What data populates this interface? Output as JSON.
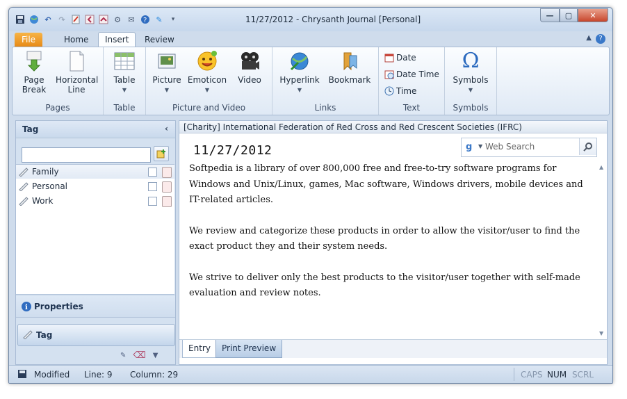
{
  "window": {
    "title": "11/27/2012 - Chrysanth Journal [Personal]",
    "controls": {
      "minimize": "—",
      "maximize": "▢",
      "close": "✕"
    }
  },
  "qat": [
    "save-icon",
    "globe-icon",
    "undo-icon",
    "redo-icon",
    "journal-icon",
    "previous-icon",
    "next-icon",
    "settings-icon",
    "mail-icon",
    "help-icon",
    "customize-icon"
  ],
  "tabs": [
    {
      "label": "File"
    },
    {
      "label": "Home"
    },
    {
      "label": "Insert"
    },
    {
      "label": "Review"
    }
  ],
  "ribbon": {
    "pages": {
      "label": "Pages",
      "page_break": "Page Break",
      "horizontal_line": "Horizontal Line"
    },
    "table": {
      "label": "Table",
      "table": "Table"
    },
    "picture_video": {
      "label": "Picture and Video",
      "picture": "Picture",
      "emoticon": "Emoticon",
      "video": "Video"
    },
    "links": {
      "label": "Links",
      "hyperlink": "Hyperlink",
      "bookmark": "Bookmark"
    },
    "text": {
      "label": "Text",
      "date": "Date",
      "date_time": "Date Time",
      "time": "Time"
    },
    "symbols": {
      "label": "Symbols",
      "symbols": "Symbols",
      "omega": "Ω"
    }
  },
  "left_pane": {
    "header": "Tag",
    "search_value": "",
    "tags": [
      {
        "label": "Family"
      },
      {
        "label": "Personal"
      },
      {
        "label": "Work"
      }
    ],
    "nav": {
      "properties": "Properties",
      "tag": "Tag"
    }
  },
  "editor": {
    "category_header": "[Charity] International Federation of Red Cross and Red Crescent Societies (IFRC)",
    "date": "11/27/2012",
    "web_search_placeholder": "Web Search",
    "paragraphs": [
      "Softpedia is a library of over 800,000 free and free-to-try software programs for Windows and Unix/Linux, games, Mac software, Windows drivers, mobile devices and IT-related articles.",
      "We review and categorize these products in order to allow the visitor/user to find the exact product they and their system needs.",
      "We strive to deliver only the best products to the visitor/user together with self-made evaluation and review notes."
    ],
    "tabs": {
      "entry": "Entry",
      "print_preview": "Print Preview"
    }
  },
  "status": {
    "modified": "Modified",
    "line": "Line: 9",
    "column": "Column: 29",
    "caps": "CAPS",
    "num": "NUM",
    "scrl": "SCRL"
  },
  "colors": {
    "accent_file": "#e78a17",
    "ribbon_bg": "#dfe9f5",
    "frame": "#cfdcec"
  }
}
